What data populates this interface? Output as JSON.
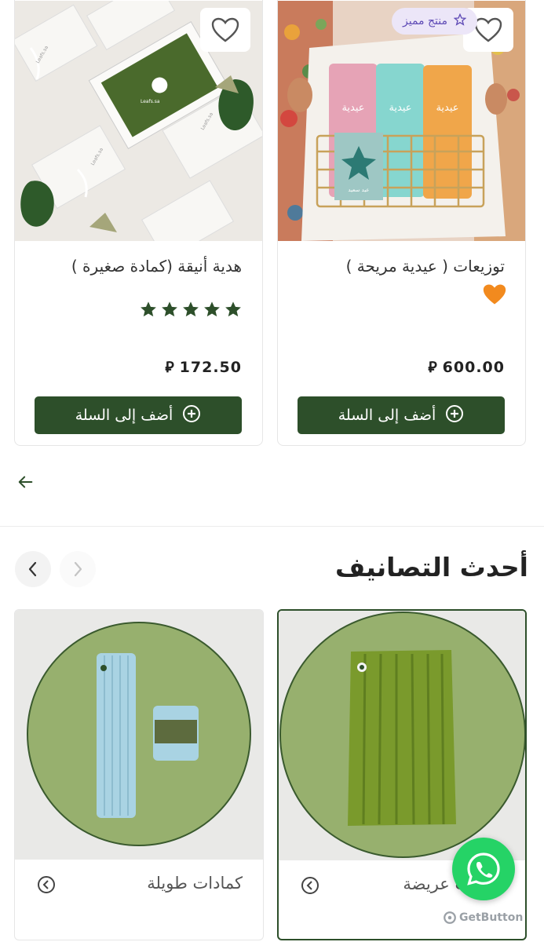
{
  "products": [
    {
      "title": "توزيعات ( عيدية مريحة )",
      "emoji": "🧡",
      "price": "600.00",
      "currency": "⃁",
      "featured_label": "منتج مميز",
      "add_label": "أضف إلى السلة",
      "image_texts": [
        "عيدية",
        "عيدية",
        "عيدية",
        "عيد سعيد"
      ]
    },
    {
      "title": "هدية أنيقة (كمادة صغيرة )",
      "rating_stars": 5,
      "price": "172.50",
      "currency": "⃁",
      "add_label": "أضف إلى السلة",
      "image_texts": [
        "Leafs.sa",
        "Leafs.sa",
        "Leafs.sa",
        "Leafs.sa"
      ]
    }
  ],
  "section": {
    "title": "أحدث التصانيف"
  },
  "categories": [
    {
      "name": "كمادات عريضة"
    },
    {
      "name": "كمادات طويلة"
    }
  ],
  "widget": {
    "label": "GetButton"
  },
  "colors": {
    "brand_green": "#2d4f2a",
    "circle_green": "#97b06e",
    "whatsapp": "#25d366",
    "featured_bg": "#ece6f8",
    "featured_text": "#5f4bb6"
  }
}
